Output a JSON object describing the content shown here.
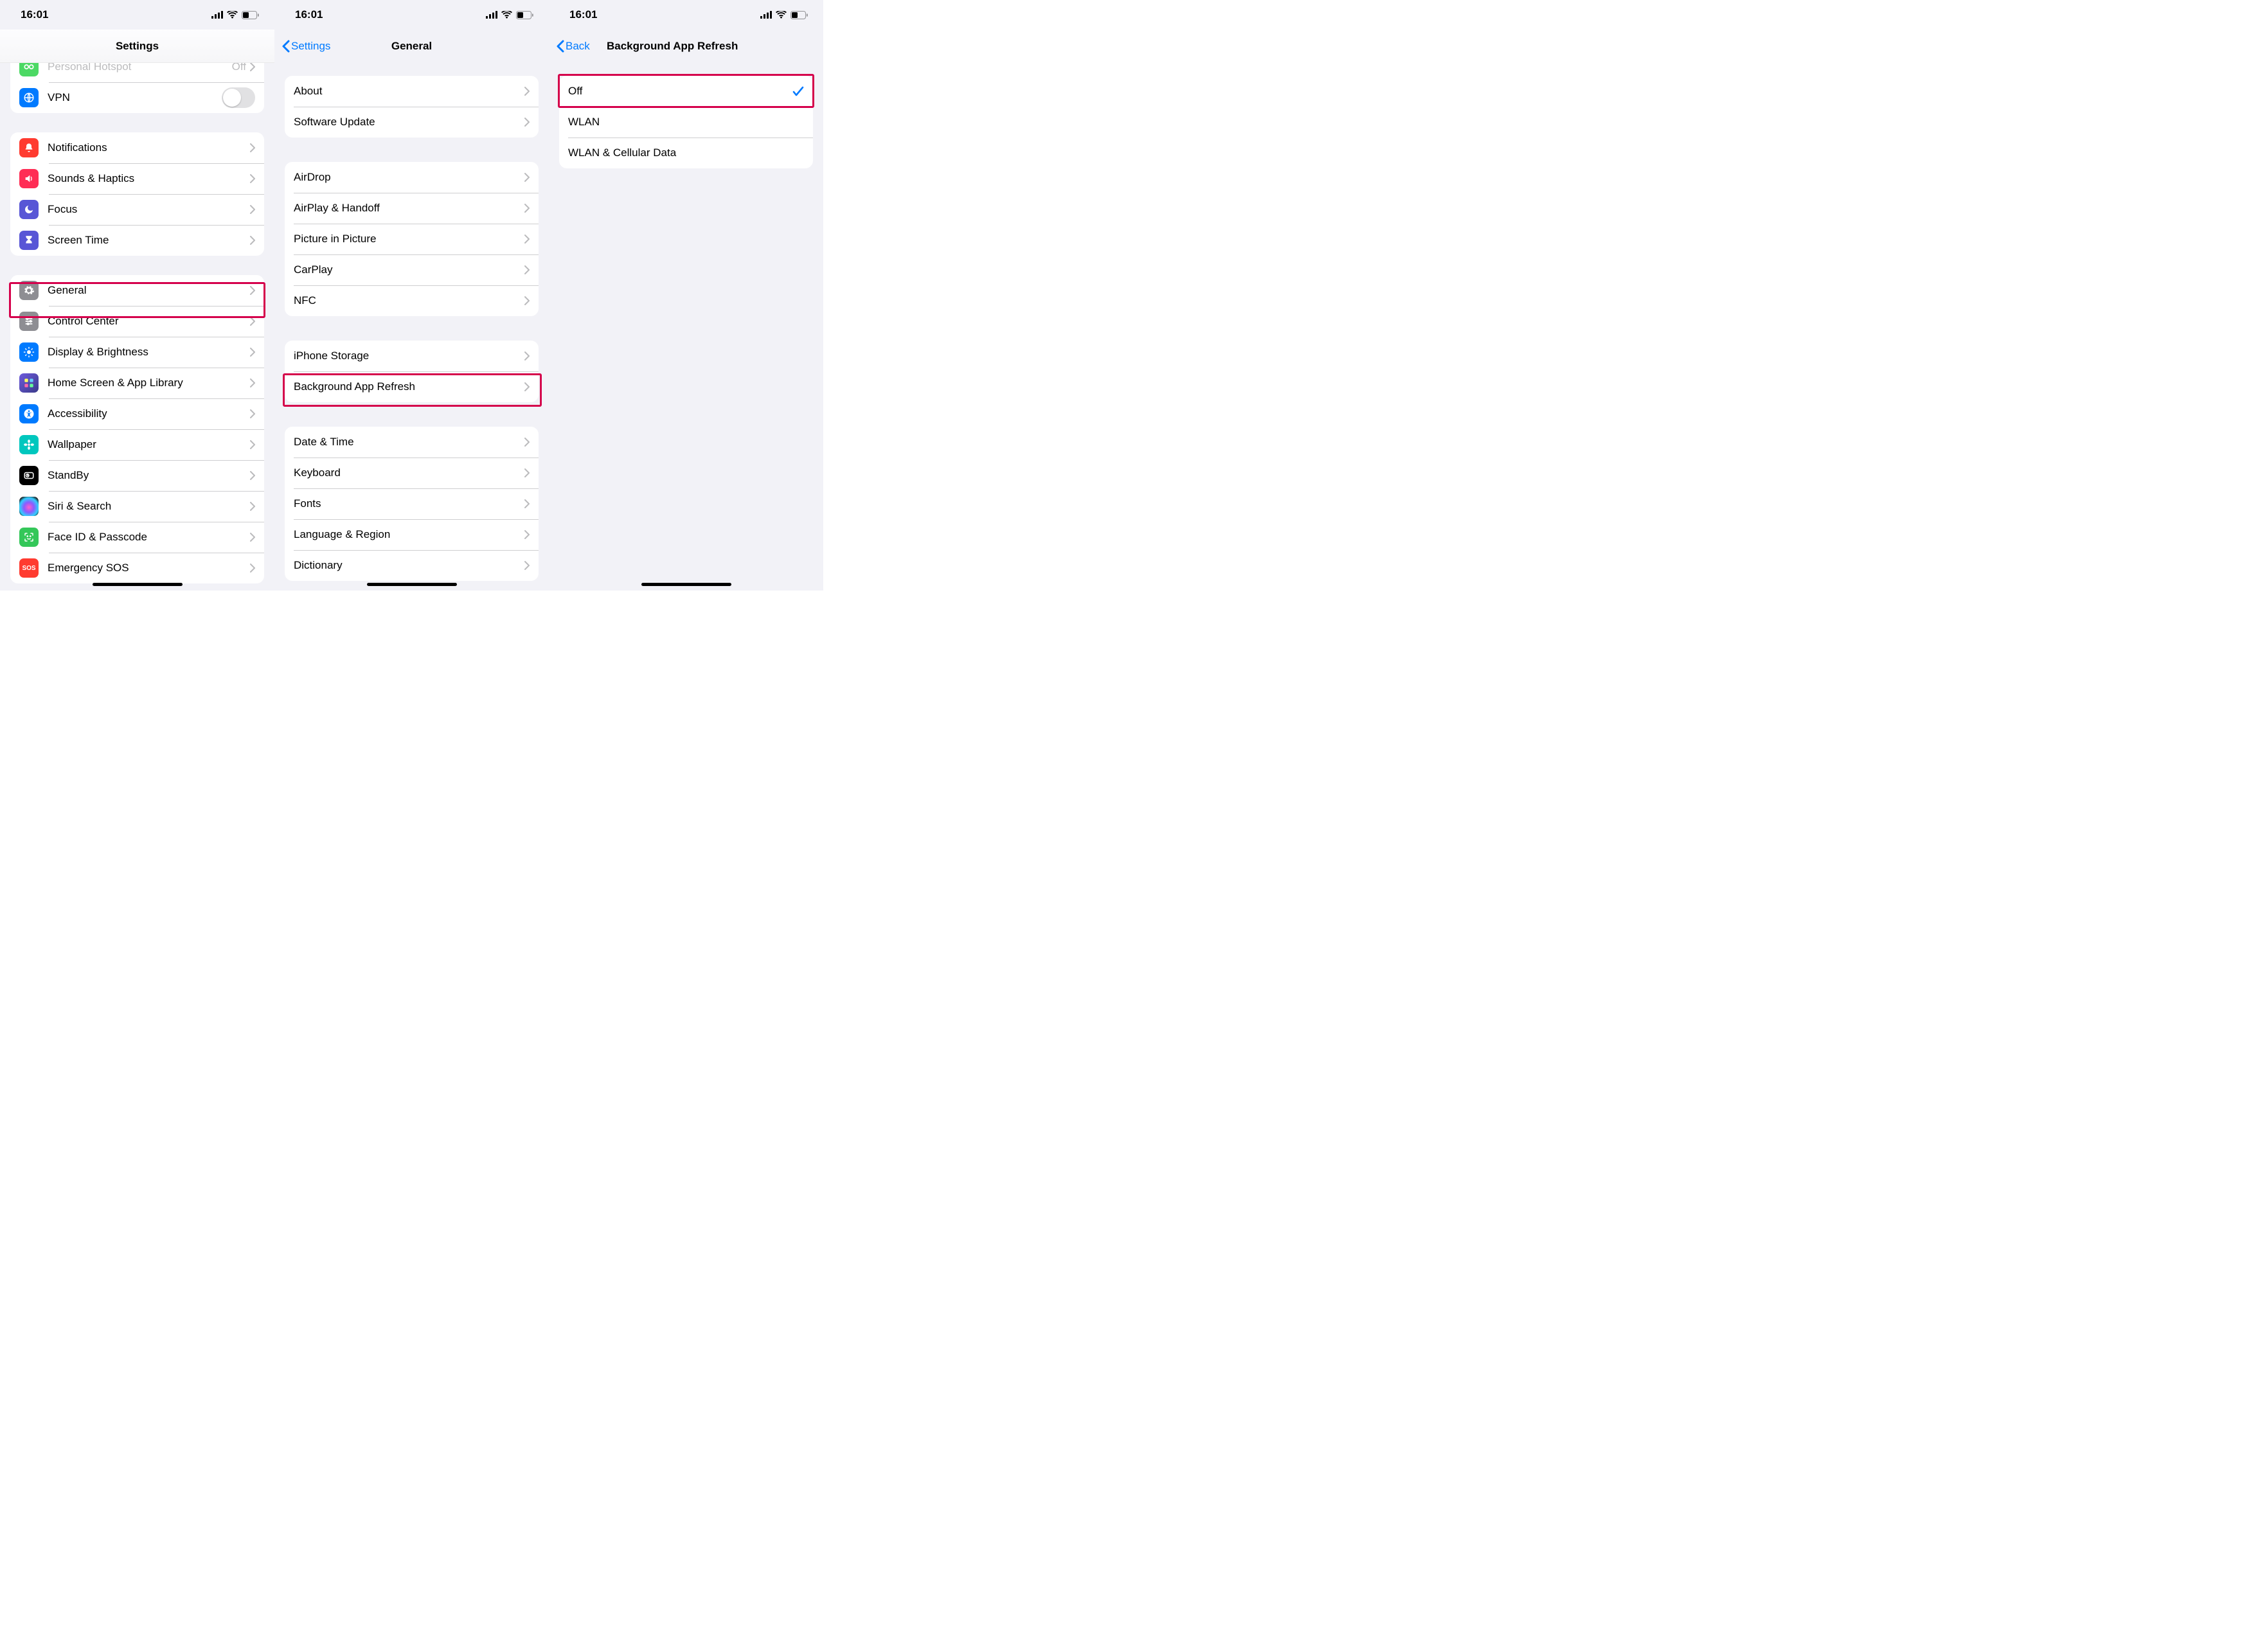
{
  "statusTime": "16:01",
  "screen1": {
    "title": "Settings",
    "partialGroup": [
      {
        "key": "personal-hotspot",
        "label": "Personal Hotspot",
        "value": "Off",
        "iconBg": "#4cd964",
        "faded": true,
        "control": "disclosure"
      },
      {
        "key": "vpn",
        "label": "VPN",
        "iconBg": "#007aff",
        "control": "toggle"
      }
    ],
    "group2": [
      {
        "key": "notifications",
        "label": "Notifications",
        "iconBg": "#ff3b30"
      },
      {
        "key": "sounds-haptics",
        "label": "Sounds & Haptics",
        "iconBg": "#ff2d55"
      },
      {
        "key": "focus",
        "label": "Focus",
        "iconBg": "#5856d6"
      },
      {
        "key": "screen-time",
        "label": "Screen Time",
        "iconBg": "#5856d6"
      }
    ],
    "group3": [
      {
        "key": "general",
        "label": "General",
        "iconBg": "#8e8e93",
        "highlight": true
      },
      {
        "key": "control-center",
        "label": "Control Center",
        "iconBg": "#8e8e93"
      },
      {
        "key": "display-brightness",
        "label": "Display & Brightness",
        "iconBg": "#007aff"
      },
      {
        "key": "home-screen",
        "label": "Home Screen & App Library",
        "iconBg": "#4040a0"
      },
      {
        "key": "accessibility",
        "label": "Accessibility",
        "iconBg": "#007aff"
      },
      {
        "key": "wallpaper",
        "label": "Wallpaper",
        "iconBg": "#00c7be"
      },
      {
        "key": "standby",
        "label": "StandBy",
        "iconBg": "#000000"
      },
      {
        "key": "siri-search",
        "label": "Siri & Search",
        "iconBg": "#1c1c1e"
      },
      {
        "key": "faceid-passcode",
        "label": "Face ID & Passcode",
        "iconBg": "#34c759"
      },
      {
        "key": "emergency-sos",
        "label": "Emergency SOS",
        "iconBg": "#ff3b30"
      }
    ]
  },
  "screen2": {
    "back": "Settings",
    "title": "General",
    "group1": [
      {
        "key": "about",
        "label": "About"
      },
      {
        "key": "software-update",
        "label": "Software Update"
      }
    ],
    "group2": [
      {
        "key": "airdrop",
        "label": "AirDrop"
      },
      {
        "key": "airplay-handoff",
        "label": "AirPlay & Handoff"
      },
      {
        "key": "picture-in-picture",
        "label": "Picture in Picture"
      },
      {
        "key": "carplay",
        "label": "CarPlay"
      },
      {
        "key": "nfc",
        "label": "NFC"
      }
    ],
    "group3": [
      {
        "key": "iphone-storage",
        "label": "iPhone Storage"
      },
      {
        "key": "background-app-refresh",
        "label": "Background App Refresh",
        "highlight": true
      }
    ],
    "group4": [
      {
        "key": "date-time",
        "label": "Date & Time"
      },
      {
        "key": "keyboard",
        "label": "Keyboard"
      },
      {
        "key": "fonts",
        "label": "Fonts"
      },
      {
        "key": "language-region",
        "label": "Language & Region"
      },
      {
        "key": "dictionary",
        "label": "Dictionary"
      }
    ]
  },
  "screen3": {
    "back": "Back",
    "title": "Background App Refresh",
    "options": [
      {
        "key": "off",
        "label": "Off",
        "checked": true,
        "highlight": true
      },
      {
        "key": "wlan",
        "label": "WLAN",
        "checked": false
      },
      {
        "key": "wlan-cellular",
        "label": "WLAN & Cellular Data",
        "checked": false
      }
    ]
  }
}
